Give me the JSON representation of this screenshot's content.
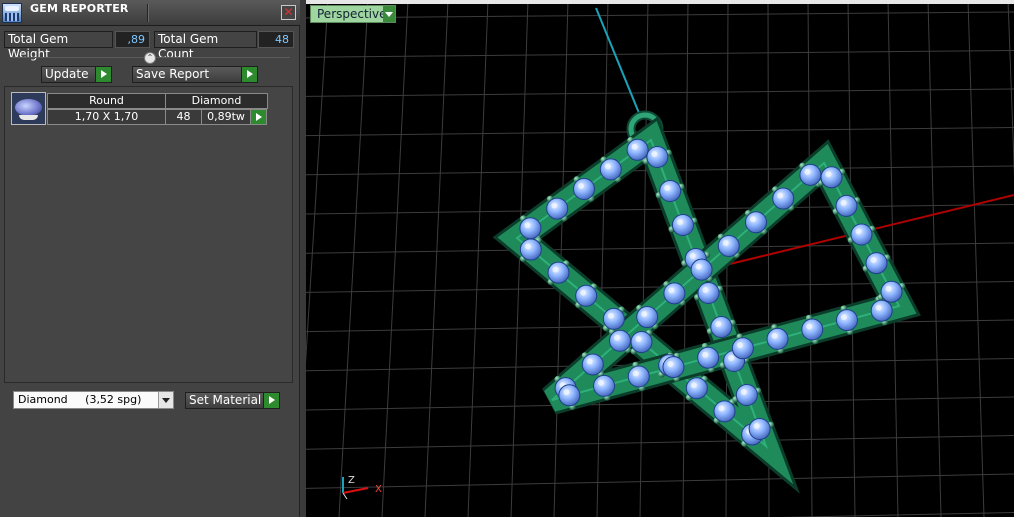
{
  "panel": {
    "title": "GEM REPORTER",
    "close_label": "✕",
    "total_weight_label": "Total Gem Weight",
    "total_weight_value": ",89",
    "total_count_label": "Total Gem Count",
    "total_count_value": "48",
    "update_label": "Update",
    "save_report_label": "Save Report",
    "collapse_glyph": "⌃"
  },
  "gem_table": {
    "headers": [
      "Round",
      "Diamond"
    ],
    "rows": [
      {
        "size": "1,70 X 1,70",
        "count": "48",
        "weight": "0,89tw"
      }
    ]
  },
  "material": {
    "selected": "Diamond     (3,52 spg)",
    "set_label": "Set Material"
  },
  "viewport": {
    "view_name": "Perspective",
    "axis_z": "Z",
    "axis_x": "X",
    "gem_count": 48
  },
  "colors": {
    "metal": "#1f8a5a",
    "stone": "#8fb6ff",
    "grid": "#3c3c3c",
    "axis_red": "#b00000",
    "axis_cyan": "#1aa3b8"
  }
}
